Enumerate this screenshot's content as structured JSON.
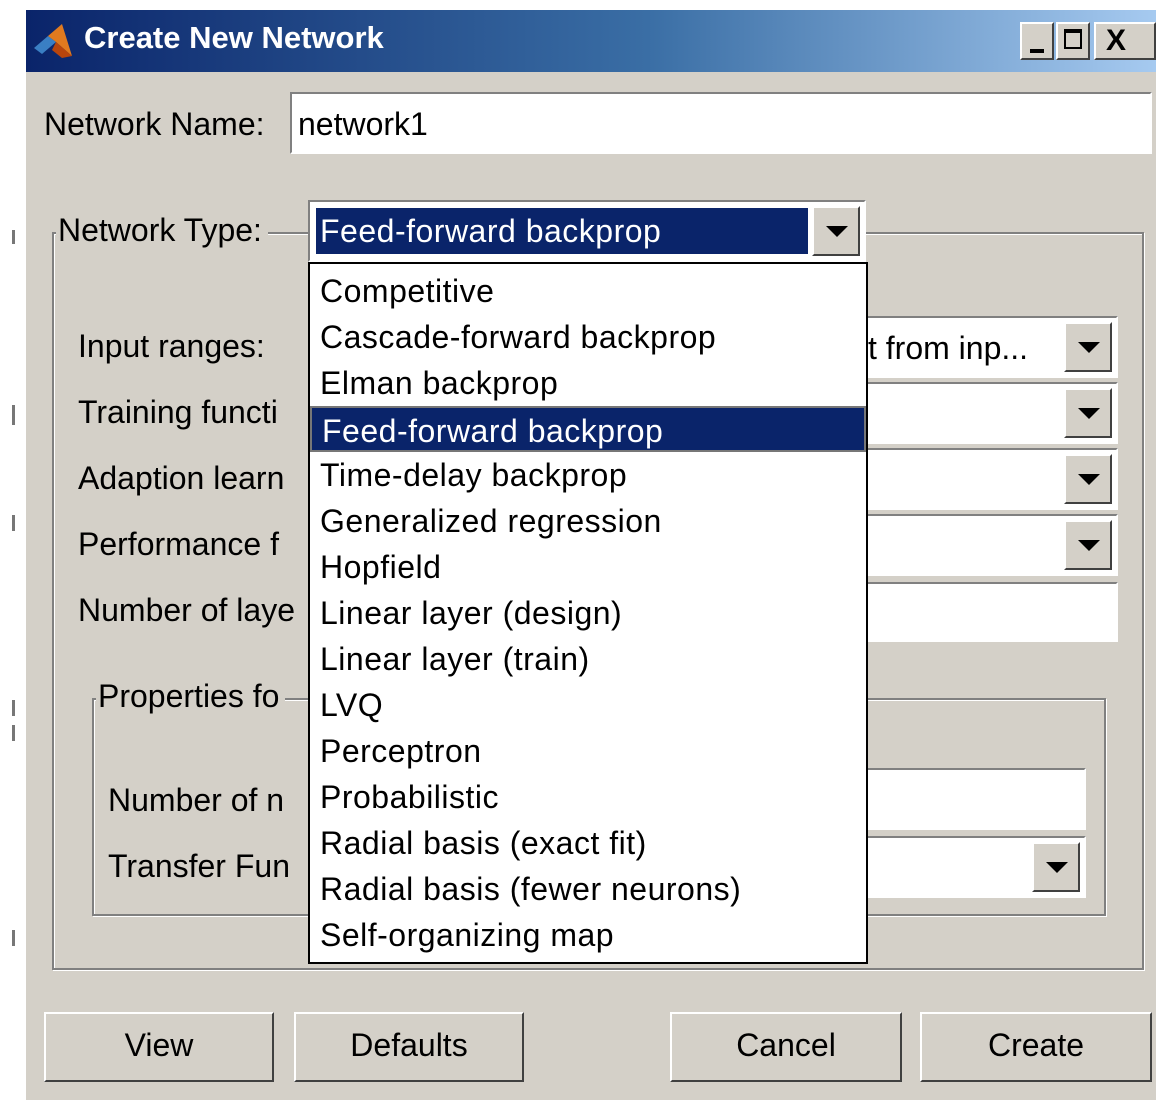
{
  "window": {
    "title": "Create New Network",
    "controls": {
      "minimize": "_",
      "maximize": "□",
      "close": "X"
    }
  },
  "network_name": {
    "label": "Network Name:",
    "value": "network1"
  },
  "network_type": {
    "label": "Network Type:",
    "selected": "Feed-forward backprop",
    "options": [
      "Competitive",
      "Cascade-forward backprop",
      "Elman backprop",
      "Feed-forward backprop",
      "Time-delay backprop",
      "Generalized regression",
      "Hopfield",
      "Linear layer (design)",
      "Linear layer (train)",
      "LVQ",
      "Perceptron",
      "Probabilistic",
      "Radial basis (exact fit)",
      "Radial basis (fewer neurons)",
      "Self-organizing map"
    ],
    "selected_index": 3
  },
  "fields": {
    "input_ranges": {
      "label": "Input ranges:",
      "value": "t from inp..."
    },
    "training_function": {
      "label": "Training functi"
    },
    "adaption_learning": {
      "label": "Adaption learn"
    },
    "performance_function": {
      "label": "Performance f"
    },
    "number_of_layers": {
      "label": "Number of laye"
    }
  },
  "properties": {
    "label": "Properties fo",
    "number_of_neurons": {
      "label": "Number of n"
    },
    "transfer_function": {
      "label": "Transfer Fun"
    }
  },
  "buttons": {
    "view": "View",
    "defaults": "Defaults",
    "cancel": "Cancel",
    "create": "Create"
  },
  "colors": {
    "dialog_bg": "#d4d0c8",
    "title_gradient_start": "#0a246a",
    "title_gradient_end": "#a6caf0",
    "selection": "#0a246a"
  }
}
